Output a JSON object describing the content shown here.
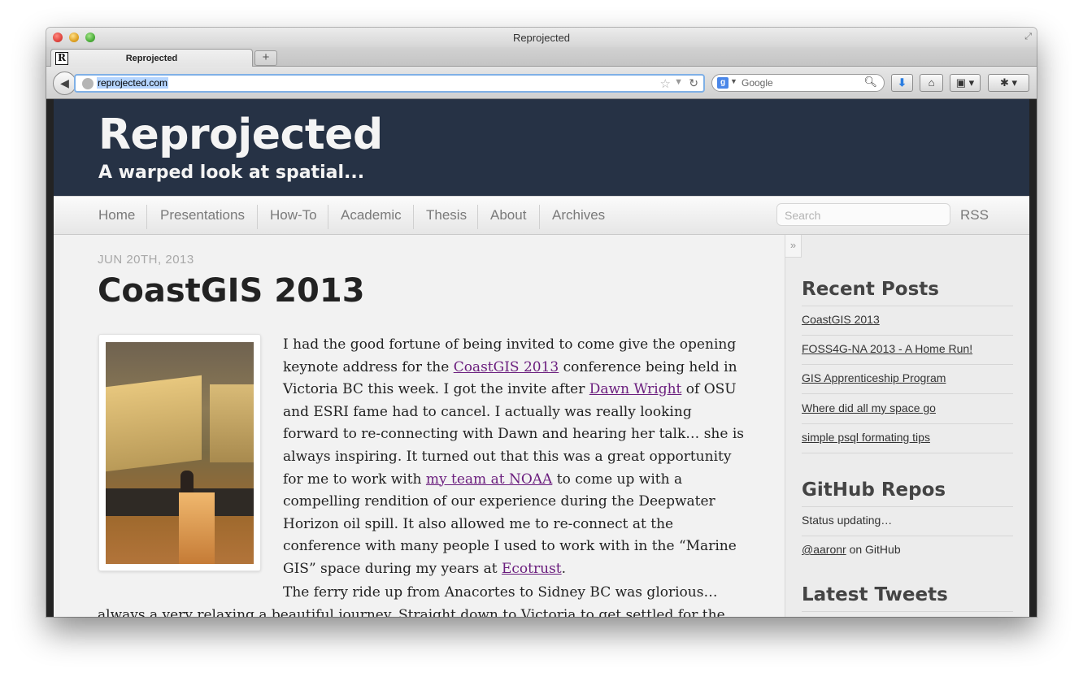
{
  "window": {
    "title": "Reprojected"
  },
  "tab": {
    "label": "Reprojected",
    "favicon_letter": "R",
    "new_tab_symbol": "+"
  },
  "toolbar": {
    "url": "reprojected.com",
    "search_placeholder": "Google",
    "google_letter": "g"
  },
  "site": {
    "title": "Reprojected",
    "subtitle": "A warped look at spatial...",
    "nav": [
      "Home",
      "Presentations",
      "How-To",
      "Academic",
      "Thesis",
      "About",
      "Archives"
    ],
    "search_placeholder": "Search",
    "rss": "RSS"
  },
  "post": {
    "date": "JUN 20TH, 2013",
    "title": "CoastGIS 2013",
    "p1": {
      "t1": "I had the good fortune of being invited to come give the opening keynote address for the ",
      "link1": "CoastGIS 2013",
      "t2": " conference being held in Victoria BC this week. I got the invite after ",
      "link2": "Dawn Wright",
      "t3": " of OSU and ESRI fame had to cancel. I actually was really looking forward to re-connecting with Dawn and hearing her talk… she is always inspiring. It turned out that this was a great opportunity for me to work with ",
      "link3": "my team at NOAA",
      "t4": " to come up with a compelling rendition of our experience during the Deepwater Horizon oil spill. It also allowed me to re-connect at the conference with many people I used to work with in the “Marine GIS” space during my years at ",
      "link4": "Ecotrust",
      "t5": "."
    },
    "p2": "The ferry ride up from Anacortes to Sidney BC was glorious… always a very relaxing a beautiful journey. Straight down to Victoria to get settled for the night at the"
  },
  "sidebar": {
    "collapse_symbol": "»",
    "recent_heading": "Recent Posts",
    "recent_posts": [
      "CoastGIS 2013",
      "FOSS4G-NA 2013 - A Home Run!",
      "GIS Apprenticeship Program",
      "Where did all my space go",
      "simple psql formating tips"
    ],
    "github_heading": "GitHub Repos",
    "github_status": "Status updating…",
    "github_user": "@aaronr",
    "github_suffix": " on GitHub",
    "tweets_heading": "Latest Tweets"
  }
}
